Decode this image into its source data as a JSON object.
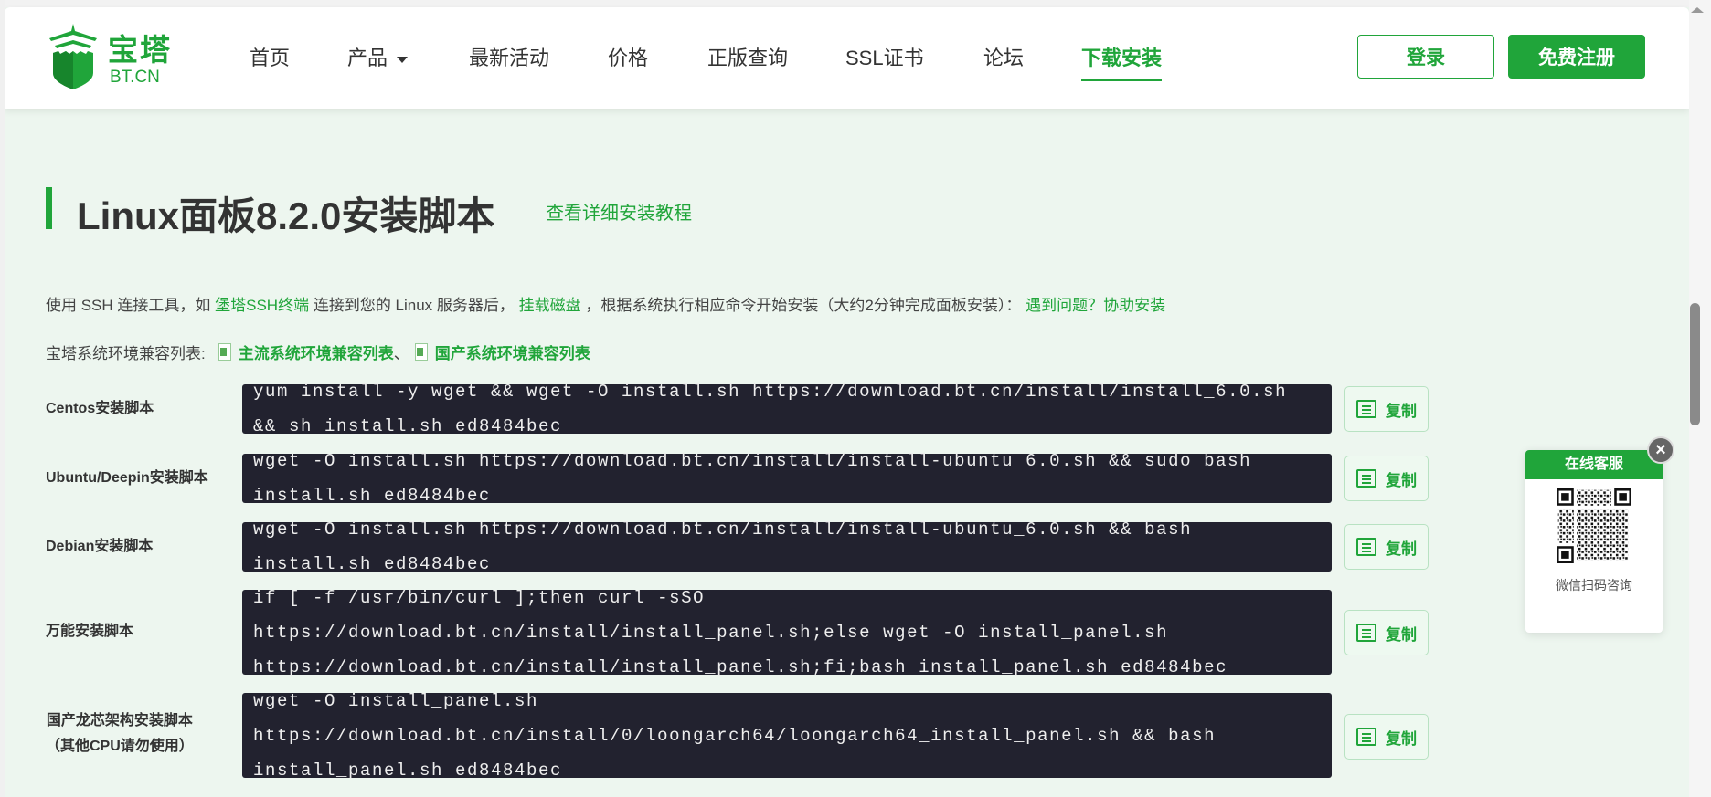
{
  "header": {
    "logo_text": "宝塔",
    "logo_sub": "BT.CN",
    "nav": [
      "首页",
      "产品",
      "最新活动",
      "价格",
      "正版查询",
      "SSL证书",
      "论坛",
      "下载安装"
    ],
    "login": "登录",
    "register": "免费注册"
  },
  "main": {
    "title": "Linux面板8.2.0安装脚本",
    "title_link": "查看详细安装教程",
    "intro": {
      "p1": "使用 SSH 连接工具，如 ",
      "link1": "堡塔SSH终端",
      "p2": " 连接到您的 Linux 服务器后，",
      "link2": "挂载磁盘",
      "p3": "，根据系统执行相应命令开始安装（大约2分钟完成面板安装）：",
      "link3": "遇到问题？协助安装"
    },
    "compat": {
      "label": "宝塔系统环境兼容列表:",
      "link1": "主流系统环境兼容列表",
      "sep": "、",
      "link2": "国产系统环境兼容列表"
    },
    "copy_label": "复制",
    "scripts": [
      {
        "label": "Centos安装脚本",
        "code": "yum install -y wget && wget -O install.sh https://download.bt.cn/install/install_6.0.sh && sh install.sh ed8484bec"
      },
      {
        "label": "Ubuntu/Deepin安装脚本",
        "code": "wget -O install.sh https://download.bt.cn/install/install-ubuntu_6.0.sh && sudo bash install.sh ed8484bec"
      },
      {
        "label": "Debian安装脚本",
        "code": "wget -O install.sh https://download.bt.cn/install/install-ubuntu_6.0.sh && bash install.sh ed8484bec"
      },
      {
        "label": "万能安装脚本",
        "code": "if [ -f /usr/bin/curl ];then curl -sSO https://download.bt.cn/install/install_panel.sh;else wget -O install_panel.sh https://download.bt.cn/install/install_panel.sh;fi;bash install_panel.sh ed8484bec"
      },
      {
        "label": "国产龙芯架构安装脚本",
        "label2": "（其他CPU请勿使用）",
        "code": "wget -O install_panel.sh https://download.bt.cn/install/0/loongarch64/loongarch64_install_panel.sh && bash install_panel.sh ed8484bec"
      }
    ]
  },
  "chat": {
    "title": "在线客服",
    "sub": "微信扫码咨询",
    "close": "×"
  }
}
